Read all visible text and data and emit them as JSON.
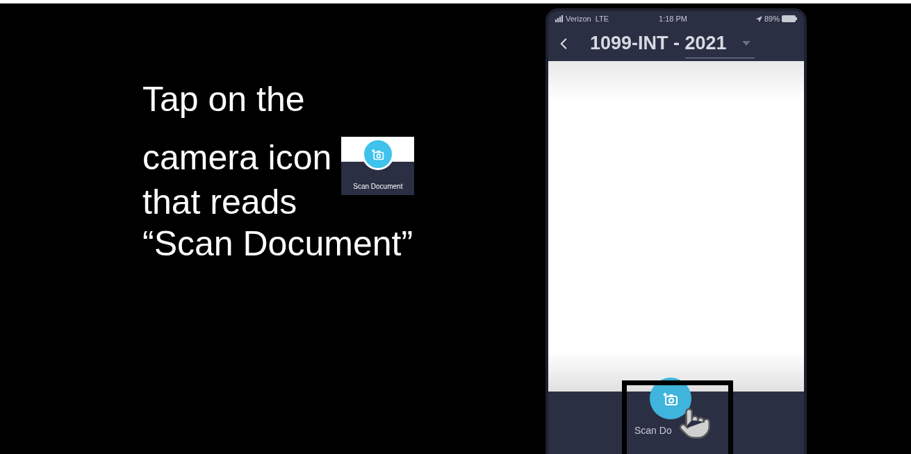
{
  "instruction": {
    "lines": [
      "Tap on the",
      "camera icon",
      "that reads",
      "“Scan Document”"
    ],
    "inset": {
      "label": "Scan Document"
    }
  },
  "phone": {
    "status_bar": {
      "carrier": "Verizon",
      "network": "LTE",
      "time": "1:18 PM",
      "battery": "89%"
    },
    "header": {
      "title": "1099-INT - ",
      "year": "2021"
    },
    "scan_button": {
      "label": "Scan Do"
    }
  }
}
